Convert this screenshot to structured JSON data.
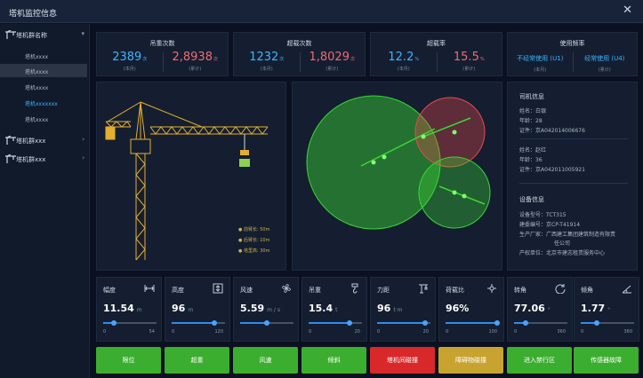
{
  "window": {
    "title": "塔机监控信息",
    "close_symbol": "✕"
  },
  "sidebar": {
    "groups": [
      {
        "label": "塔机群名称",
        "arrow": "▾",
        "expanded": true
      },
      {
        "label": "塔机群xxx",
        "arrow": "›"
      },
      {
        "label": "塔机群xxx",
        "arrow": "›"
      }
    ],
    "items": [
      {
        "label": "塔机xxxx"
      },
      {
        "label": "塔机xxxx",
        "selected": true
      },
      {
        "label": "塔机xxxx"
      },
      {
        "label": "塔机xxxxxxx",
        "active": true
      },
      {
        "label": "塔机xxxx"
      }
    ]
  },
  "stats": [
    {
      "title": "吊重次数",
      "left": {
        "value": "2389",
        "unit": "次",
        "sub": "(本月)",
        "color": "#3ab5ff"
      },
      "right": {
        "value": "2,8938",
        "unit": "次",
        "sub": "(累计)",
        "color": "#ef6b73"
      }
    },
    {
      "title": "超载次数",
      "left": {
        "value": "1232",
        "unit": "次",
        "sub": "(本月)",
        "color": "#3ab5ff"
      },
      "right": {
        "value": "1,8029",
        "unit": "次",
        "sub": "(累计)",
        "color": "#ef6b73"
      }
    },
    {
      "title": "超载率",
      "left": {
        "value": "12.2",
        "unit": "%",
        "sub": "(本月)",
        "color": "#3ab5ff"
      },
      "right": {
        "value": "15.5",
        "unit": "%",
        "sub": "(累计)",
        "color": "#ef6b73"
      }
    },
    {
      "title": "使用频率",
      "left": {
        "value": "不经常使用 (U1)",
        "sub": "(本月)"
      },
      "right": {
        "value": "经常使用 (U4)",
        "sub": "(累计)"
      }
    }
  ],
  "crane_legend": [
    {
      "text": "前臂长: 50m"
    },
    {
      "text": "后臂长: 10m"
    },
    {
      "text": "塔里高: 30m"
    }
  ],
  "driver_info": {
    "heading": "司机信息",
    "drivers": [
      {
        "name": "姓名：白银",
        "age": "年龄：28",
        "cert": "证件：京A042014006676"
      },
      {
        "name": "姓名：赵红",
        "age": "年龄：36",
        "cert": "证件：京A042011005921"
      }
    ]
  },
  "device_info": {
    "heading": "设备信息",
    "model": "设备型号：TCT315",
    "code": "建委编号：京CP-T41914",
    "maker_1": "生产厂家：广西建工集团建筑制造有限责",
    "maker_2": "任公司",
    "owner": "产权单位：北京市建志租赁服务中心"
  },
  "metrics": [
    {
      "label": "幅度",
      "value": "11.54",
      "unit": "m",
      "min": "0",
      "max": "54",
      "level": 0.2,
      "icon": "amplitude-icon"
    },
    {
      "label": "高度",
      "value": "96",
      "unit": "m",
      "min": "0",
      "max": "120",
      "level": 0.8,
      "icon": "height-icon"
    },
    {
      "label": "风速",
      "value": "5.59",
      "unit": "m / s",
      "min": "",
      "max": "",
      "level": 0.5,
      "icon": "fan-icon"
    },
    {
      "label": "吊重",
      "value": "15.4",
      "unit": "t",
      "min": "0",
      "max": "20",
      "level": 0.77,
      "icon": "hook-icon"
    },
    {
      "label": "力距",
      "value": "96",
      "unit": "t·m",
      "min": "0",
      "max": "20",
      "level": 0.9,
      "icon": "moment-icon"
    },
    {
      "label": "荷载比",
      "value": "96%",
      "unit": "",
      "min": "0",
      "max": "100",
      "level": 0.96,
      "icon": "load-ratio-icon"
    },
    {
      "label": "转角",
      "value": "77.06",
      "unit": "°",
      "min": "0",
      "max": "360",
      "level": 0.21,
      "icon": "rotation-icon"
    },
    {
      "label": "倾角",
      "value": "1.77",
      "unit": "°",
      "min": "0",
      "max": "360",
      "level": 0.3,
      "icon": "tilt-icon"
    }
  ],
  "alarms": [
    {
      "label": "限位",
      "color": "#3cae2f"
    },
    {
      "label": "超重",
      "color": "#3cae2f"
    },
    {
      "label": "风速",
      "color": "#3cae2f"
    },
    {
      "label": "倾斜",
      "color": "#3cae2f"
    },
    {
      "label": "塔机间碰撞",
      "color": "#d9282a"
    },
    {
      "label": "障碍物碰撞",
      "color": "#c9a32f"
    },
    {
      "label": "进入禁行区",
      "color": "#3cae2f"
    },
    {
      "label": "传感器故障",
      "color": "#3cae2f"
    }
  ],
  "colors": {
    "background": "#0b1120",
    "panel": "#141e30",
    "accent_blue": "#3ab5ff",
    "accent_red": "#ef6b73",
    "crane_yellow": "#e3ad2f",
    "zone_green": "#39d834",
    "zone_red": "#e84a4a"
  }
}
